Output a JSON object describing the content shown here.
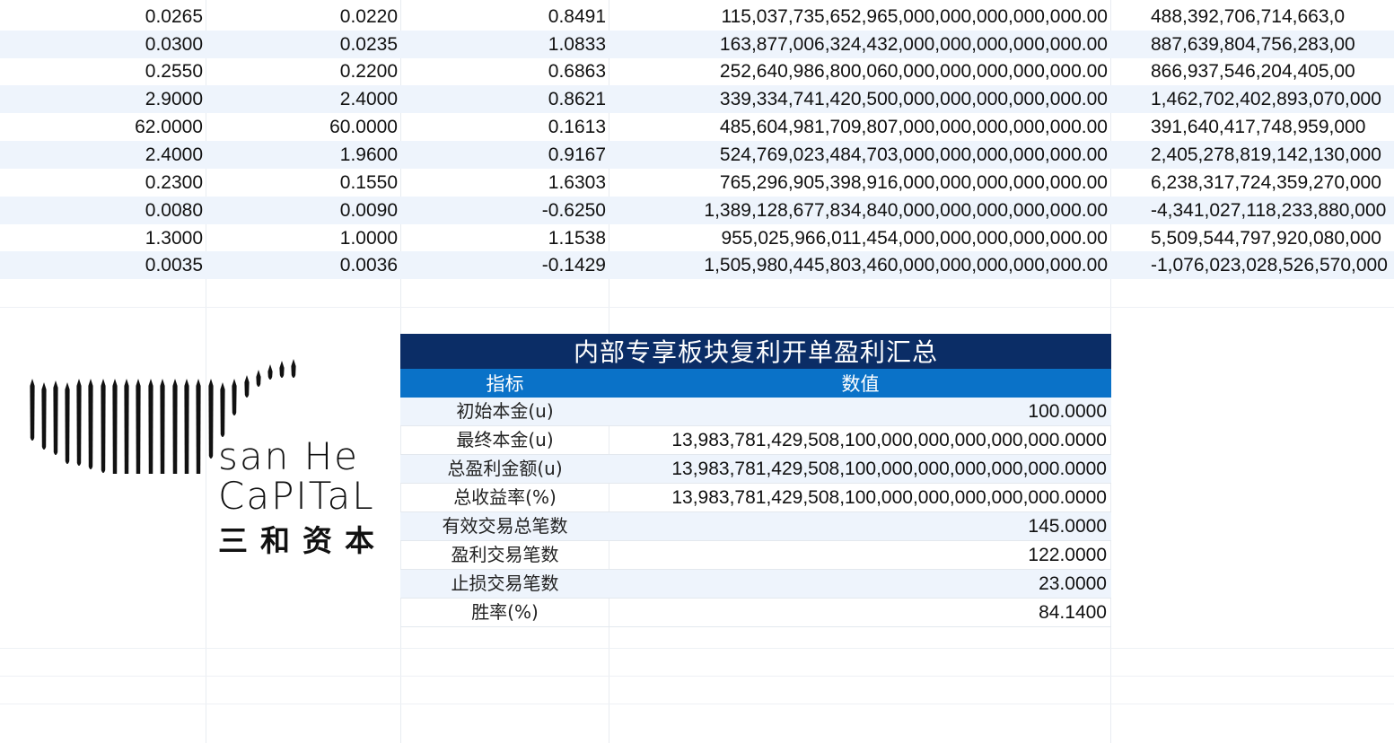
{
  "rows": [
    [
      "0.0265",
      "0.0220",
      "0.8491",
      "115,037,735,652,965,000,000,000,000,000.00",
      "488,392,706,714,663,0"
    ],
    [
      "0.0300",
      "0.0235",
      "1.0833",
      "163,877,006,324,432,000,000,000,000,000.00",
      "887,639,804,756,283,00"
    ],
    [
      "0.2550",
      "0.2200",
      "0.6863",
      "252,640,986,800,060,000,000,000,000,000.00",
      "866,937,546,204,405,00"
    ],
    [
      "2.9000",
      "2.4000",
      "0.8621",
      "339,334,741,420,500,000,000,000,000,000.00",
      "1,462,702,402,893,070,000"
    ],
    [
      "62.0000",
      "60.0000",
      "0.1613",
      "485,604,981,709,807,000,000,000,000,000.00",
      "391,640,417,748,959,000"
    ],
    [
      "2.4000",
      "1.9600",
      "0.9167",
      "524,769,023,484,703,000,000,000,000,000.00",
      "2,405,278,819,142,130,000"
    ],
    [
      "0.2300",
      "0.1550",
      "1.6303",
      "765,296,905,398,916,000,000,000,000,000.00",
      "6,238,317,724,359,270,000"
    ],
    [
      "0.0080",
      "0.0090",
      "-0.6250",
      "1,389,128,677,834,840,000,000,000,000,000.00",
      "-4,341,027,118,233,880,000"
    ],
    [
      "1.3000",
      "1.0000",
      "1.1538",
      "955,025,966,011,454,000,000,000,000,000.00",
      "5,509,544,797,920,080,000"
    ],
    [
      "0.0035",
      "0.0036",
      "-0.1429",
      "1,505,980,445,803,460,000,000,000,000,000.00",
      "-1,076,023,028,526,570,000"
    ]
  ],
  "summary": {
    "title": "内部专享板块复利开单盈利汇总",
    "header_metric": "指标",
    "header_value": "数值",
    "items": [
      {
        "label": "初始本金(u)",
        "value": "100.0000"
      },
      {
        "label": "最终本金(u)",
        "value": "13,983,781,429,508,100,000,000,000,000,000.0000"
      },
      {
        "label": "总盈利金额(u)",
        "value": "13,983,781,429,508,100,000,000,000,000,000.0000"
      },
      {
        "label": "总收益率(%)",
        "value": "13,983,781,429,508,100,000,000,000,000,000.0000"
      },
      {
        "label": "有效交易总笔数",
        "value": "145.0000"
      },
      {
        "label": "盈利交易笔数",
        "value": "122.0000"
      },
      {
        "label": "止损交易笔数",
        "value": "23.0000"
      },
      {
        "label": "胜率(%)",
        "value": "84.1400"
      }
    ]
  },
  "logo": {
    "line1": "san He",
    "line2": "CaPITaL",
    "cn": "三和资本"
  }
}
